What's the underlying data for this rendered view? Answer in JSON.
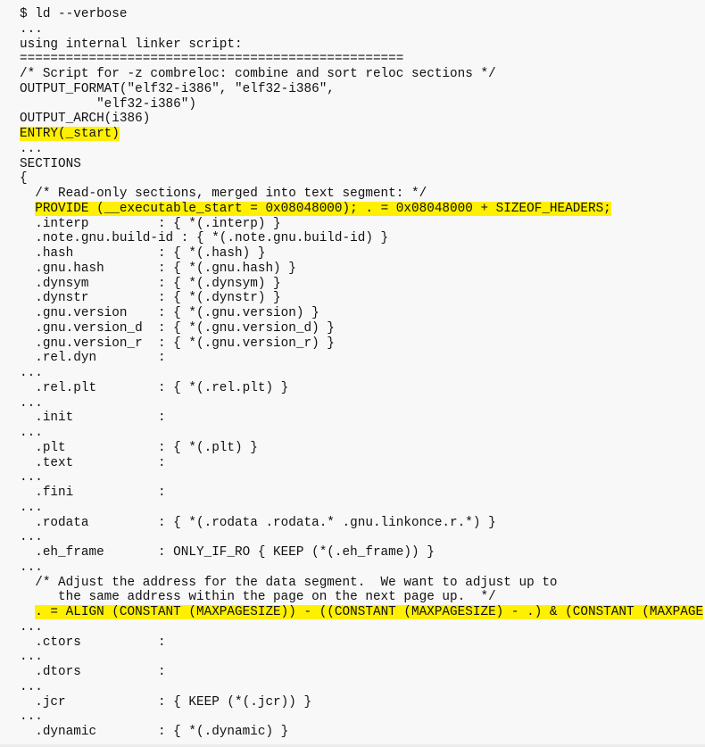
{
  "terminal": {
    "command": "$ ld --verbose",
    "lines": [
      {
        "text": "$ ld --verbose",
        "highlight": false
      },
      {
        "text": "...",
        "highlight": false
      },
      {
        "text": "using internal linker script:",
        "highlight": false
      },
      {
        "text": "==================================================",
        "highlight": false
      },
      {
        "text": "/* Script for -z combreloc: combine and sort reloc sections */",
        "highlight": false
      },
      {
        "text": "OUTPUT_FORMAT(\"elf32-i386\", \"elf32-i386\",",
        "highlight": false
      },
      {
        "text": "          \"elf32-i386\")",
        "highlight": false
      },
      {
        "text": "OUTPUT_ARCH(i386)",
        "highlight": false
      },
      {
        "text": "ENTRY(_start)",
        "highlight": true
      },
      {
        "text": "...",
        "highlight": false
      },
      {
        "text": "SECTIONS",
        "highlight": false
      },
      {
        "text": "{",
        "highlight": false
      },
      {
        "text": "  /* Read-only sections, merged into text segment: */",
        "highlight": false
      },
      {
        "text": "  PROVIDE (__executable_start = 0x08048000); . = 0x08048000 + SIZEOF_HEADERS;",
        "highlight": true
      },
      {
        "text": "  .interp         : { *(.interp) }",
        "highlight": false
      },
      {
        "text": "  .note.gnu.build-id : { *(.note.gnu.build-id) }",
        "highlight": false
      },
      {
        "text": "  .hash           : { *(.hash) }",
        "highlight": false
      },
      {
        "text": "  .gnu.hash       : { *(.gnu.hash) }",
        "highlight": false
      },
      {
        "text": "  .dynsym         : { *(.dynsym) }",
        "highlight": false
      },
      {
        "text": "  .dynstr         : { *(.dynstr) }",
        "highlight": false
      },
      {
        "text": "  .gnu.version    : { *(.gnu.version) }",
        "highlight": false
      },
      {
        "text": "  .gnu.version_d  : { *(.gnu.version_d) }",
        "highlight": false
      },
      {
        "text": "  .gnu.version_r  : { *(.gnu.version_r) }",
        "highlight": false
      },
      {
        "text": "  .rel.dyn        :",
        "highlight": false
      },
      {
        "text": "...",
        "highlight": false
      },
      {
        "text": "  .rel.plt        : { *(.rel.plt) }",
        "highlight": false
      },
      {
        "text": "...",
        "highlight": false
      },
      {
        "text": "  .init           :",
        "highlight": false
      },
      {
        "text": "...",
        "highlight": false
      },
      {
        "text": "  .plt            : { *(.plt) }",
        "highlight": false
      },
      {
        "text": "  .text           :",
        "highlight": false
      },
      {
        "text": "...",
        "highlight": false
      },
      {
        "text": "  .fini           :",
        "highlight": false
      },
      {
        "text": "...",
        "highlight": false
      },
      {
        "text": "  .rodata         : { *(.rodata .rodata.* .gnu.linkonce.r.*) }",
        "highlight": false
      },
      {
        "text": "...",
        "highlight": false
      },
      {
        "text": "  .eh_frame       : ONLY_IF_RO { KEEP (*(.eh_frame)) }",
        "highlight": false
      },
      {
        "text": "...",
        "highlight": false
      },
      {
        "text": "  /* Adjust the address for the data segment.  We want to adjust up to",
        "highlight": false
      },
      {
        "text": "     the same address within the page on the next page up.  */",
        "highlight": false
      },
      {
        "text": "  . = ALIGN (CONSTANT (MAXPAGESIZE)) - ((CONSTANT (MAXPAGESIZE) - .) & (CONSTANT (MAXPAGE",
        "highlight": true
      },
      {
        "text": "...",
        "highlight": false
      },
      {
        "text": "  .ctors          :",
        "highlight": false
      },
      {
        "text": "...",
        "highlight": false
      },
      {
        "text": "  .dtors          :",
        "highlight": false
      },
      {
        "text": "...",
        "highlight": false
      },
      {
        "text": "  .jcr            : { KEEP (*(.jcr)) }",
        "highlight": false
      },
      {
        "text": "...",
        "highlight": false
      },
      {
        "text": "  .dynamic        : { *(.dynamic) }",
        "highlight": false
      }
    ]
  },
  "colors": {
    "background": "#f8f8f8",
    "text": "#111111",
    "highlight": "#fff000"
  }
}
